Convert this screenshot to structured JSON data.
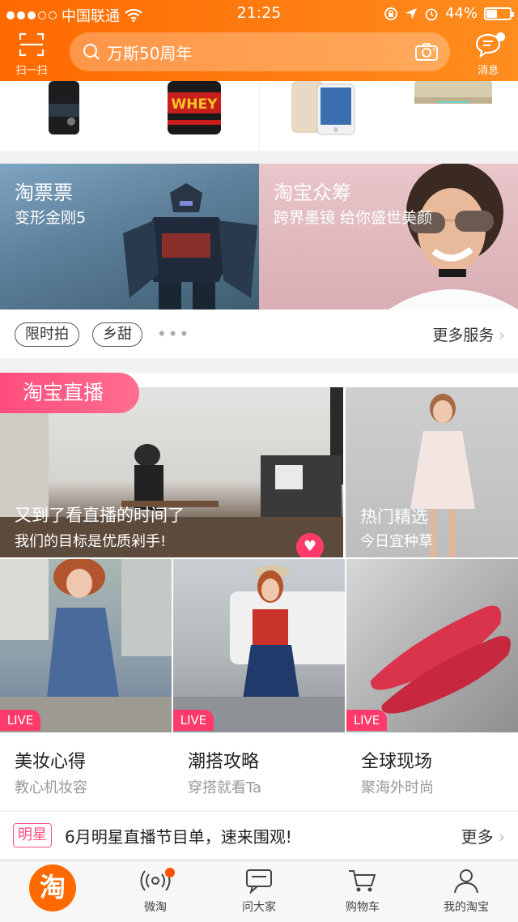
{
  "status_bar": {
    "carrier": "中国联通",
    "time": "21:25",
    "battery": "44%"
  },
  "header": {
    "scan_label": "扫一扫",
    "search_text": "万斯50周年",
    "message_label": "消息"
  },
  "promos": [
    {
      "title": "淘票票",
      "subtitle": "变形金刚5"
    },
    {
      "title": "淘宝众筹",
      "subtitle": "跨界墨镜 给你盛世美颜"
    }
  ],
  "services": {
    "tags": [
      "限时拍",
      "乡甜"
    ],
    "more": "更多服务"
  },
  "live": {
    "section_title": "淘宝直播",
    "main": {
      "title": "又到了看直播的时间了",
      "subtitle": "我们的目标是优质剁手!"
    },
    "hot": {
      "title": "热门精选",
      "subtitle": "今日宜种草"
    },
    "live_badge": "LIVE",
    "cards": [
      {
        "title": "美妆心得",
        "subtitle": "教心机妆容"
      },
      {
        "title": "潮搭攻略",
        "subtitle": "穿搭就看Ta"
      },
      {
        "title": "全球现场",
        "subtitle": "聚海外时尚"
      }
    ]
  },
  "star_row": {
    "badge": "明星",
    "text": "6月明星直播节目单，速来围观!",
    "more": "更多"
  },
  "tabbar": {
    "home_logo": "淘",
    "tabs": [
      "微淘",
      "问大家",
      "购物车",
      "我的淘宝"
    ]
  },
  "colors": {
    "brand_orange": "#ff6a00",
    "live_pink": "#ff3b6b"
  }
}
